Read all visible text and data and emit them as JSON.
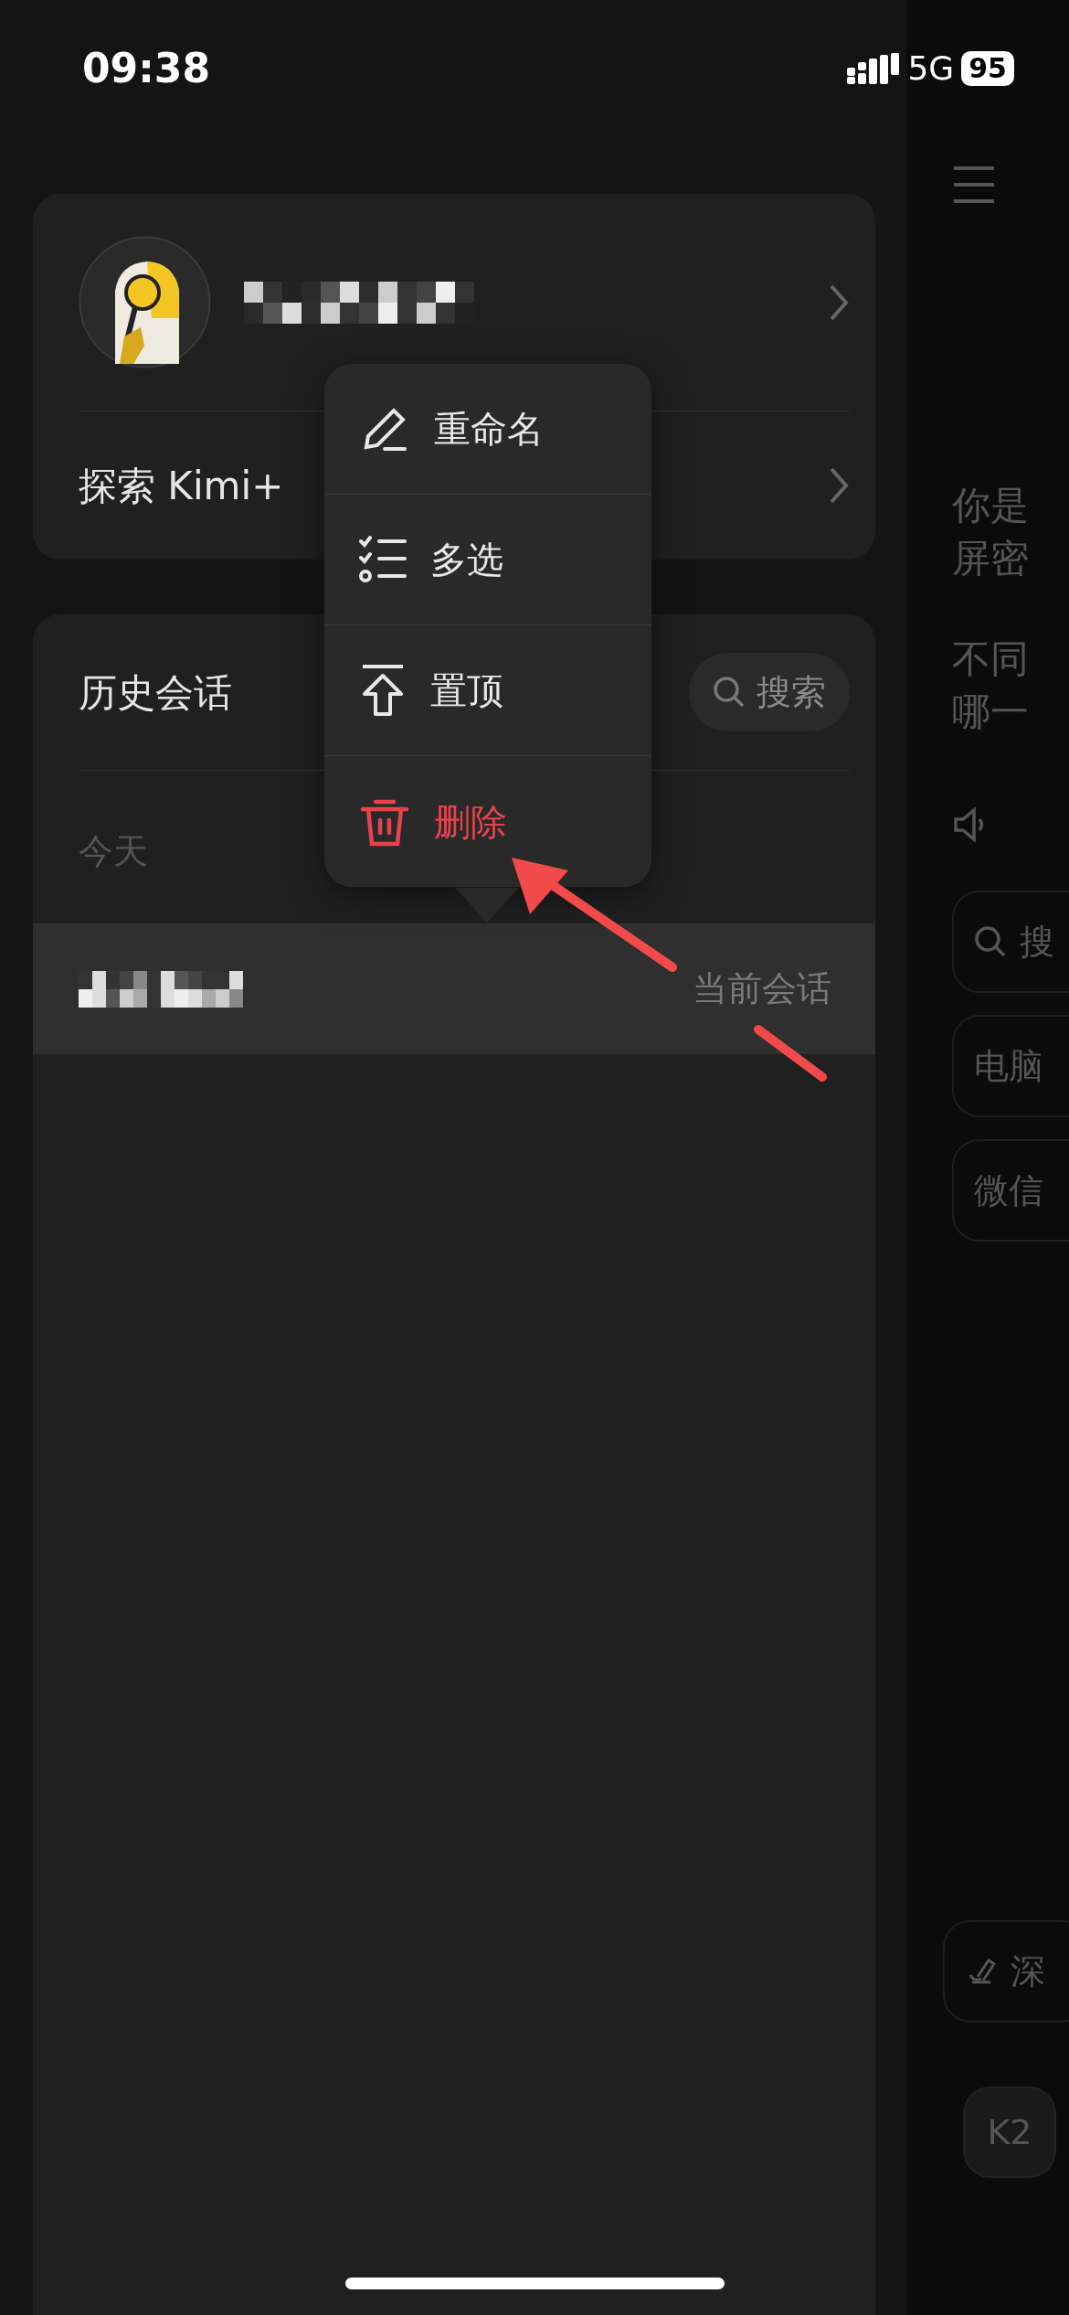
{
  "status_bar": {
    "time": "09:38",
    "network": "5G",
    "battery": "95"
  },
  "profile": {
    "explore_label": "探索 Kimi+"
  },
  "history": {
    "title": "历史会话",
    "search_label": "搜索",
    "section": "今天",
    "conversations": [
      {
        "badge": "当前会话",
        "selected": true
      }
    ]
  },
  "context_menu": {
    "items": [
      {
        "label": "重命名",
        "kind": "rename"
      },
      {
        "label": "多选",
        "kind": "multi-select"
      },
      {
        "label": "置顶",
        "kind": "pin"
      },
      {
        "label": "删除",
        "kind": "delete"
      }
    ]
  },
  "main": {
    "lines": [
      "你是",
      "屏密",
      "不同",
      "哪一"
    ],
    "chips": [
      {
        "label": "搜",
        "kind": "search"
      },
      {
        "label": "电脑",
        "kind": "plain"
      },
      {
        "label": "微信",
        "kind": "plain"
      }
    ],
    "mode_chip": "深",
    "model_button": "K2"
  }
}
